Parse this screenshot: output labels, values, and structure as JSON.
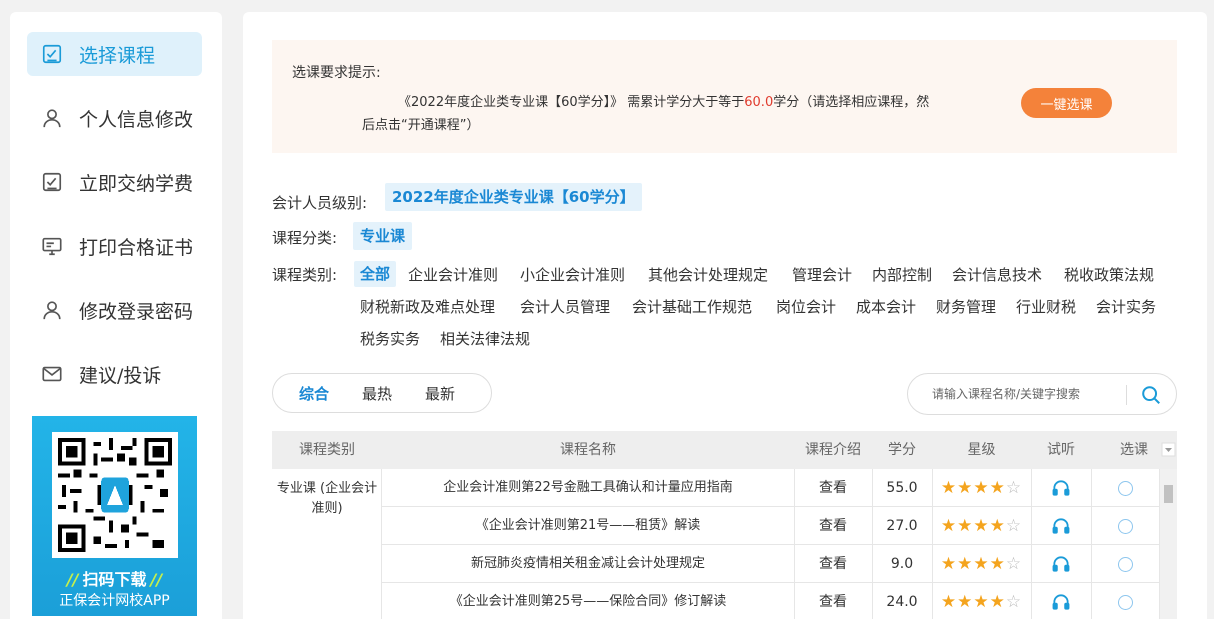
{
  "sidebar": {
    "items": [
      {
        "label": "选择课程",
        "icon": "checkbox-icon"
      },
      {
        "label": "个人信息修改",
        "icon": "person-icon"
      },
      {
        "label": "立即交纳学费",
        "icon": "checkbox-icon"
      },
      {
        "label": "打印合格证书",
        "icon": "certificate-icon"
      },
      {
        "label": "修改登录密码",
        "icon": "person-icon"
      },
      {
        "label": "建议/投诉",
        "icon": "mail-icon"
      }
    ],
    "qr": {
      "line1": "扫码下载",
      "line2": "正保会计网校APP"
    }
  },
  "notice": {
    "title": "选课要求提示:",
    "body_pre": "《2022年度企业类专业课【60学分】》 需累计学分大于等于",
    "credits": "60.0",
    "body_post": "学分（请选择相应课程，然后点击“开通课程”）",
    "button": "一键选课"
  },
  "filters": {
    "level_label": "会计人员级别:",
    "level_value": "2022年度企业类专业课【60学分】",
    "category_label": "课程分类:",
    "category_value": "专业课",
    "type_label": "课程类别:",
    "types": [
      "全部",
      "企业会计准则",
      "小企业会计准则",
      "其他会计处理规定",
      "管理会计",
      "内部控制",
      "会计信息技术",
      "税收政策法规",
      "财税新政及难点处理",
      "会计人员管理",
      "会计基础工作规范",
      "岗位会计",
      "成本会计",
      "财务管理",
      "行业财税",
      "会计实务",
      "税务实务",
      "相关法律法规"
    ]
  },
  "sort": {
    "tabs": [
      "综合",
      "最热",
      "最新"
    ]
  },
  "search": {
    "placeholder": "请输入课程名称/关键字搜索"
  },
  "table": {
    "headers": [
      "课程类别",
      "课程名称",
      "课程介绍",
      "学分",
      "星级",
      "试听",
      "选课"
    ],
    "group_label": "专业课 (企业会计准则)",
    "rows": [
      {
        "name": "企业会计准则第22号金融工具确认和计量应用指南",
        "intro": "查看",
        "credit": "55.0",
        "stars": 4
      },
      {
        "name": "《企业会计准则第21号——租赁》解读",
        "intro": "查看",
        "credit": "27.0",
        "stars": 4
      },
      {
        "name": "新冠肺炎疫情相关租金减让会计处理规定",
        "intro": "查看",
        "credit": "9.0",
        "stars": 4
      },
      {
        "name": "《企业会计准则第25号——保险合同》修订解读",
        "intro": "查看",
        "credit": "24.0",
        "stars": 4
      }
    ]
  },
  "colors": {
    "accent": "#1a88d4",
    "orange": "#f4823a",
    "red": "#e03b2e",
    "star": "#f4a41e"
  }
}
